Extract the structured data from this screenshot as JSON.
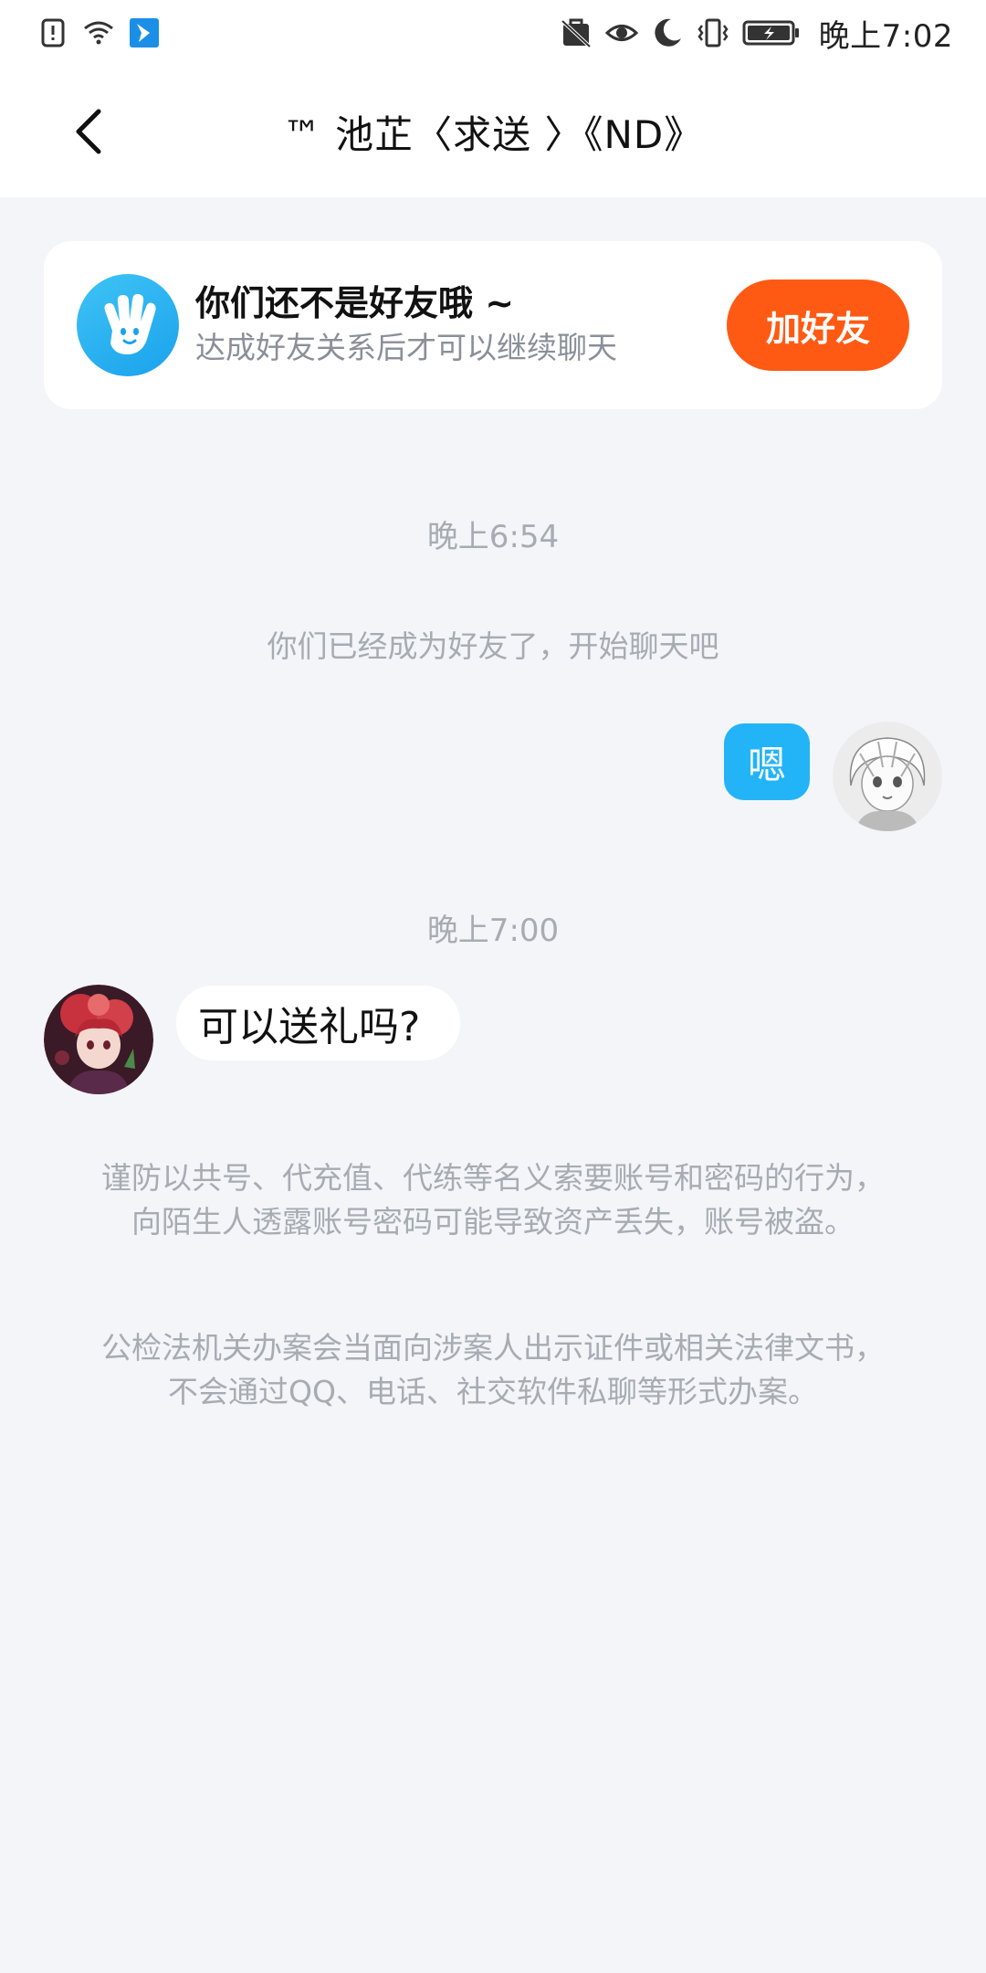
{
  "status_bar": {
    "time": "晚上7:02",
    "left_icons": [
      "sim-alert-icon",
      "wifi-icon",
      "app-notification-icon"
    ],
    "right_icons": [
      "no-notification-icon",
      "eye-icon",
      "moon-icon",
      "vibrate-icon",
      "battery-icon"
    ]
  },
  "header": {
    "title": "™ 池芷〈求送 〉《ND》"
  },
  "friend_banner": {
    "title": "你们还不是好友哦 ~",
    "subtitle": "达成好友关系后才可以继续聊天",
    "button_label": "加好友",
    "button_color": "#ff5a14"
  },
  "chat": {
    "time_1": "晚上6:54",
    "system_message": "你们已经成为好友了，开始聊天吧",
    "outgoing_message": "嗯",
    "time_2": "晚上7:00",
    "incoming_message": "可以送礼吗?"
  },
  "warnings": {
    "warning_1": "谨防以共号、代充值、代练等名义索要账号和密码的行为，向陌生人透露账号密码可能导致资产丢失，账号被盗。",
    "warning_2": "公检法机关办案会当面向涉案人出示证件或相关法律文书，不会通过QQ、电话、社交软件私聊等形式办案。"
  },
  "colors": {
    "accent_blue": "#23b4f7",
    "background": "#f3f5f8"
  }
}
